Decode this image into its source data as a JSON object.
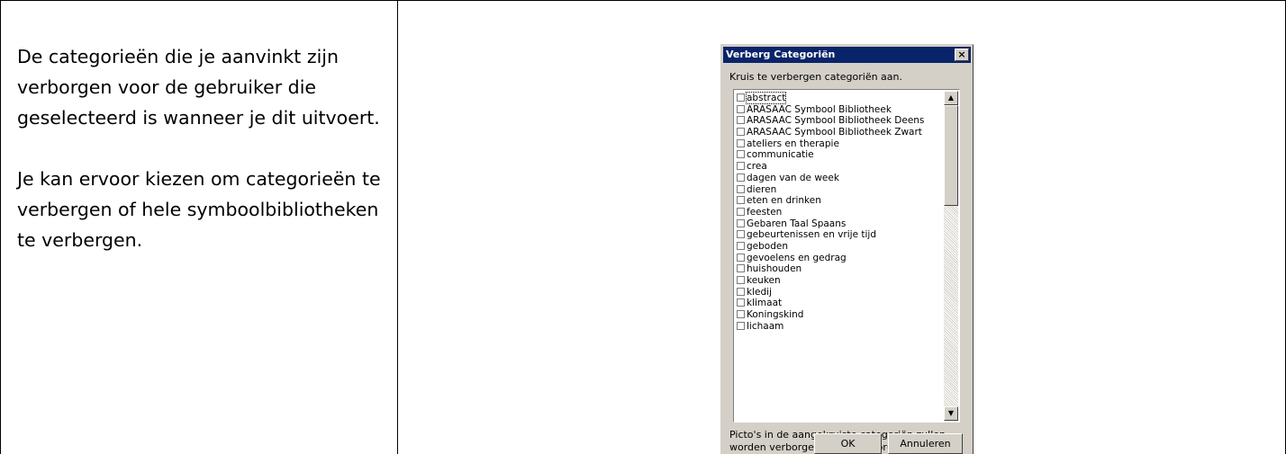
{
  "left_text": {
    "paragraph1": "De categorieën die je aanvinkt zijn verborgen voor de gebruiker die geselecteerd is wanneer je dit uitvoert.",
    "paragraph2": "Je kan ervoor kiezen om categorieën te verbergen of hele symboolbibliotheken te verbergen."
  },
  "dialog": {
    "title": "Verberg Categoriën",
    "close_label": "×",
    "instruction": "Kruis te verbergen categoriën aan.",
    "items": [
      {
        "label": "abstract",
        "checked": false
      },
      {
        "label": "ARASAAC Symbool Bibliotheek",
        "checked": false
      },
      {
        "label": "ARASAAC Symbool Bibliotheek Deens",
        "checked": false
      },
      {
        "label": "ARASAAC Symbool Bibliotheek Zwart",
        "checked": false
      },
      {
        "label": "ateliers en therapie",
        "checked": false
      },
      {
        "label": "communicatie",
        "checked": false
      },
      {
        "label": "crea",
        "checked": false
      },
      {
        "label": "dagen van de week",
        "checked": false
      },
      {
        "label": "dieren",
        "checked": false
      },
      {
        "label": "eten en drinken",
        "checked": false
      },
      {
        "label": "feesten",
        "checked": false
      },
      {
        "label": "Gebaren Taal Spaans",
        "checked": false
      },
      {
        "label": "gebeurtenissen en vrije tijd",
        "checked": false
      },
      {
        "label": "geboden",
        "checked": false
      },
      {
        "label": "gevoelens en gedrag",
        "checked": false
      },
      {
        "label": "huishouden",
        "checked": false
      },
      {
        "label": "keuken",
        "checked": false
      },
      {
        "label": "kledij",
        "checked": false
      },
      {
        "label": "klimaat",
        "checked": false
      },
      {
        "label": "Koningskind",
        "checked": false
      },
      {
        "label": "lichaam",
        "checked": false
      }
    ],
    "note": "Picto's in de aangekruiste categoriën zullen worden verborgen voor de gebruiker.",
    "ok_label": "OK",
    "cancel_label": "Annuleren",
    "scroll_up_icon": "▲",
    "scroll_down_icon": "▼"
  },
  "colors": {
    "titlebar": "#0a246a",
    "dialog_face": "#d4d0c8"
  }
}
